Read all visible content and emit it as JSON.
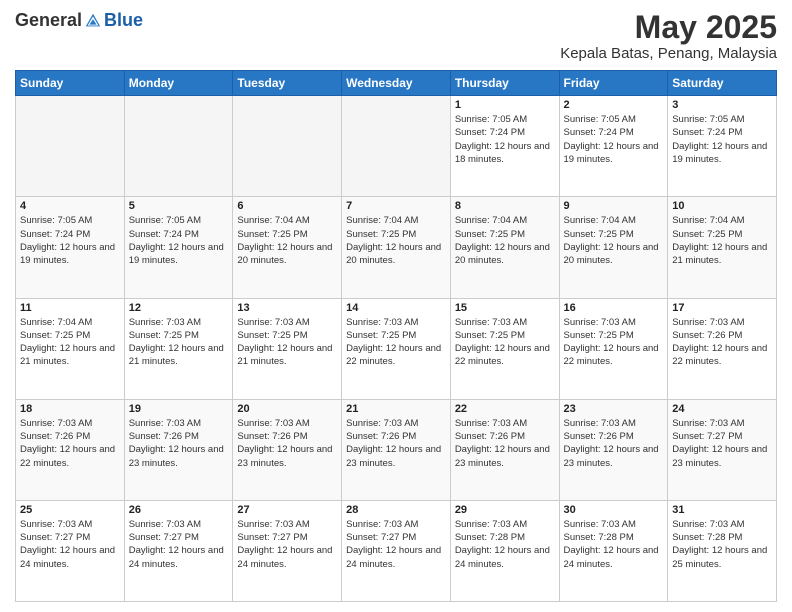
{
  "header": {
    "logo_general": "General",
    "logo_blue": "Blue",
    "month_title": "May 2025",
    "location": "Kepala Batas, Penang, Malaysia"
  },
  "calendar": {
    "days_of_week": [
      "Sunday",
      "Monday",
      "Tuesday",
      "Wednesday",
      "Thursday",
      "Friday",
      "Saturday"
    ],
    "weeks": [
      [
        {
          "day": "",
          "empty": true
        },
        {
          "day": "",
          "empty": true
        },
        {
          "day": "",
          "empty": true
        },
        {
          "day": "",
          "empty": true
        },
        {
          "day": "1",
          "sunrise": "7:05 AM",
          "sunset": "7:24 PM",
          "daylight": "12 hours and 18 minutes."
        },
        {
          "day": "2",
          "sunrise": "7:05 AM",
          "sunset": "7:24 PM",
          "daylight": "12 hours and 19 minutes."
        },
        {
          "day": "3",
          "sunrise": "7:05 AM",
          "sunset": "7:24 PM",
          "daylight": "12 hours and 19 minutes."
        }
      ],
      [
        {
          "day": "4",
          "sunrise": "7:05 AM",
          "sunset": "7:24 PM",
          "daylight": "12 hours and 19 minutes."
        },
        {
          "day": "5",
          "sunrise": "7:05 AM",
          "sunset": "7:24 PM",
          "daylight": "12 hours and 19 minutes."
        },
        {
          "day": "6",
          "sunrise": "7:04 AM",
          "sunset": "7:25 PM",
          "daylight": "12 hours and 20 minutes."
        },
        {
          "day": "7",
          "sunrise": "7:04 AM",
          "sunset": "7:25 PM",
          "daylight": "12 hours and 20 minutes."
        },
        {
          "day": "8",
          "sunrise": "7:04 AM",
          "sunset": "7:25 PM",
          "daylight": "12 hours and 20 minutes."
        },
        {
          "day": "9",
          "sunrise": "7:04 AM",
          "sunset": "7:25 PM",
          "daylight": "12 hours and 20 minutes."
        },
        {
          "day": "10",
          "sunrise": "7:04 AM",
          "sunset": "7:25 PM",
          "daylight": "12 hours and 21 minutes."
        }
      ],
      [
        {
          "day": "11",
          "sunrise": "7:04 AM",
          "sunset": "7:25 PM",
          "daylight": "12 hours and 21 minutes."
        },
        {
          "day": "12",
          "sunrise": "7:03 AM",
          "sunset": "7:25 PM",
          "daylight": "12 hours and 21 minutes."
        },
        {
          "day": "13",
          "sunrise": "7:03 AM",
          "sunset": "7:25 PM",
          "daylight": "12 hours and 21 minutes."
        },
        {
          "day": "14",
          "sunrise": "7:03 AM",
          "sunset": "7:25 PM",
          "daylight": "12 hours and 22 minutes."
        },
        {
          "day": "15",
          "sunrise": "7:03 AM",
          "sunset": "7:25 PM",
          "daylight": "12 hours and 22 minutes."
        },
        {
          "day": "16",
          "sunrise": "7:03 AM",
          "sunset": "7:25 PM",
          "daylight": "12 hours and 22 minutes."
        },
        {
          "day": "17",
          "sunrise": "7:03 AM",
          "sunset": "7:26 PM",
          "daylight": "12 hours and 22 minutes."
        }
      ],
      [
        {
          "day": "18",
          "sunrise": "7:03 AM",
          "sunset": "7:26 PM",
          "daylight": "12 hours and 22 minutes."
        },
        {
          "day": "19",
          "sunrise": "7:03 AM",
          "sunset": "7:26 PM",
          "daylight": "12 hours and 23 minutes."
        },
        {
          "day": "20",
          "sunrise": "7:03 AM",
          "sunset": "7:26 PM",
          "daylight": "12 hours and 23 minutes."
        },
        {
          "day": "21",
          "sunrise": "7:03 AM",
          "sunset": "7:26 PM",
          "daylight": "12 hours and 23 minutes."
        },
        {
          "day": "22",
          "sunrise": "7:03 AM",
          "sunset": "7:26 PM",
          "daylight": "12 hours and 23 minutes."
        },
        {
          "day": "23",
          "sunrise": "7:03 AM",
          "sunset": "7:26 PM",
          "daylight": "12 hours and 23 minutes."
        },
        {
          "day": "24",
          "sunrise": "7:03 AM",
          "sunset": "7:27 PM",
          "daylight": "12 hours and 23 minutes."
        }
      ],
      [
        {
          "day": "25",
          "sunrise": "7:03 AM",
          "sunset": "7:27 PM",
          "daylight": "12 hours and 24 minutes."
        },
        {
          "day": "26",
          "sunrise": "7:03 AM",
          "sunset": "7:27 PM",
          "daylight": "12 hours and 24 minutes."
        },
        {
          "day": "27",
          "sunrise": "7:03 AM",
          "sunset": "7:27 PM",
          "daylight": "12 hours and 24 minutes."
        },
        {
          "day": "28",
          "sunrise": "7:03 AM",
          "sunset": "7:27 PM",
          "daylight": "12 hours and 24 minutes."
        },
        {
          "day": "29",
          "sunrise": "7:03 AM",
          "sunset": "7:28 PM",
          "daylight": "12 hours and 24 minutes."
        },
        {
          "day": "30",
          "sunrise": "7:03 AM",
          "sunset": "7:28 PM",
          "daylight": "12 hours and 24 minutes."
        },
        {
          "day": "31",
          "sunrise": "7:03 AM",
          "sunset": "7:28 PM",
          "daylight": "12 hours and 25 minutes."
        }
      ]
    ]
  }
}
